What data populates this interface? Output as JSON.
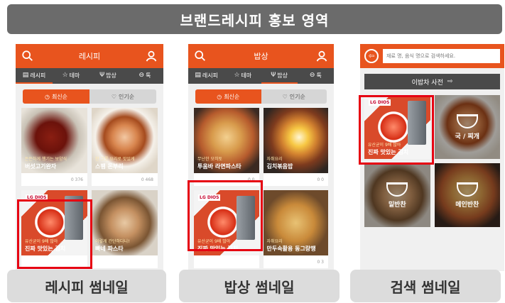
{
  "banner": "브랜드레시피 홍보 영역",
  "labels": [
    "레시피 썸네일",
    "밥상 썸네일",
    "검색 썸네일"
  ],
  "colors": {
    "accent": "#e8541e",
    "dark": "#4a4a4a",
    "highlight": "#e60012"
  },
  "recipe": {
    "title": "레시피",
    "tabs": [
      "레시피",
      "테마",
      "밥상",
      "톡"
    ],
    "toggle": [
      "최신순",
      "인기순"
    ],
    "cards": [
      {
        "cap1": "든든하게 챙기는 보양식",
        "cap2": "버섯고기완자",
        "stats": "0   376"
      },
      {
        "cap1": "한 그릇 요리로 맛있게",
        "cap2": "스팸 돈부리",
        "stats": "0   468"
      },
      {
        "cap1": "유산균이 9배 많아",
        "cap2": "진짜 맛있는 김치"
      },
      {
        "cap1": "이렇게 간단하다니!",
        "cap2": "빠네 파스타"
      }
    ]
  },
  "table": {
    "title": "밥상",
    "tabs": [
      "레시피",
      "테마",
      "밥상",
      "톡"
    ],
    "toggle": [
      "최신순",
      "인기순"
    ],
    "cards": [
      {
        "cap1": "무난한 모히토",
        "cap2": "투움바 라면파스타",
        "stats": "0   0"
      },
      {
        "cap1": "자취요리",
        "cap2": "김치볶음밥",
        "stats": "0   0"
      },
      {
        "cap1": "유산균이 9배 많아",
        "cap2": "진짜 맛있는 김치"
      },
      {
        "cap1": "자취요리",
        "cap2": "만두속활용 동그랑땡",
        "stats": "0   3"
      }
    ]
  },
  "search": {
    "placeholder": "재료 명, 음식 명으로 검색하세요.",
    "dict": "이밥차 사전",
    "cards": [
      {
        "cap1": "유산균이 9배 많아",
        "cap2": "진짜 맛있는 김치"
      },
      {
        "label": "국 / 찌개"
      },
      {
        "label": "밑반찬"
      },
      {
        "label": "메인반찬"
      }
    ]
  }
}
